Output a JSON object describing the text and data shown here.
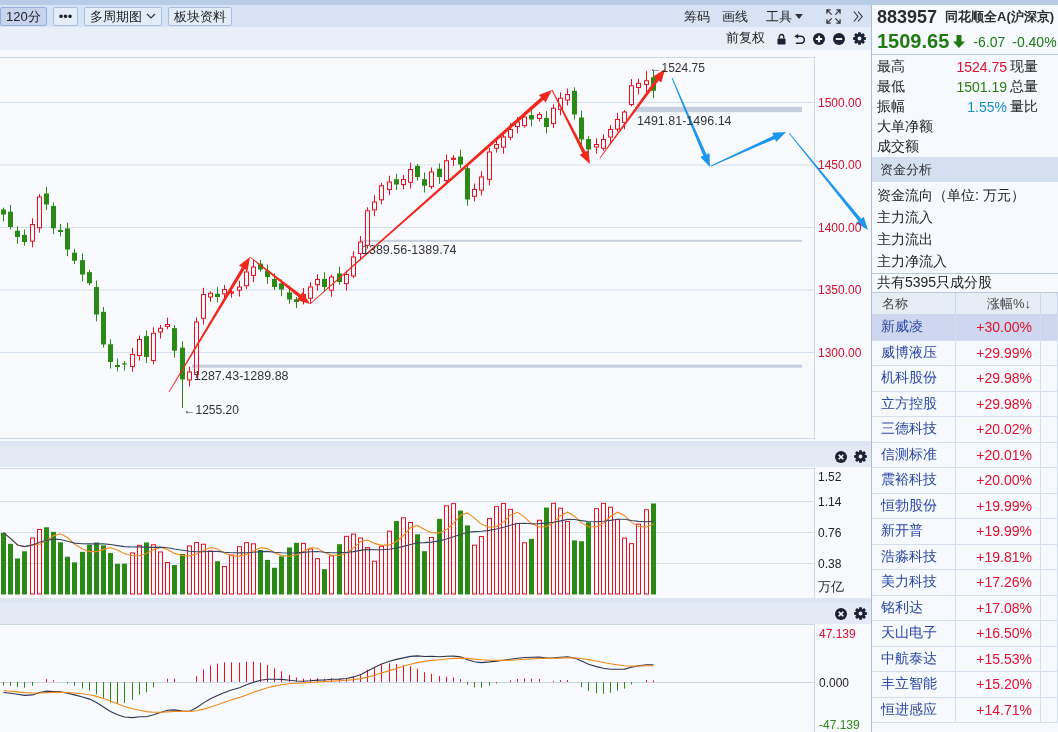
{
  "toolbar": {
    "buttons": [
      {
        "label": "120分",
        "selected": true,
        "kind": "plain"
      },
      {
        "label": "•••",
        "selected": false,
        "kind": "plain"
      },
      {
        "label": "多周期图",
        "selected": false,
        "kind": "dropdown"
      },
      {
        "label": "板块资料",
        "selected": false,
        "kind": "plain"
      }
    ],
    "tools": [
      {
        "label": "筹码",
        "kind": "plain"
      },
      {
        "label": "画线",
        "kind": "plain"
      },
      {
        "label": "工具",
        "kind": "menu"
      }
    ]
  },
  "chart_toolbar": {
    "adjustment": "前复权"
  },
  "price_chart": {
    "axis_labels": [
      "1500.00",
      "1450.00",
      "1400.00",
      "1350.00",
      "1300.00"
    ],
    "high_label": "←1524.75",
    "low_label": "←1255.20",
    "zones": [
      {
        "label": "1491.81-1496.14"
      },
      {
        "label": "1389.56-1389.74"
      },
      {
        "label": "1287.43-1289.88"
      }
    ]
  },
  "volume_panel": {
    "axis_labels": [
      "1.52",
      "1.14",
      "0.76",
      "0.38"
    ],
    "unit": "万亿"
  },
  "macd_panel": {
    "axis_labels": [
      {
        "label": "47.139",
        "color": "#d8102c"
      },
      {
        "label": "0.000",
        "color": "#222222"
      },
      {
        "label": "-47.139",
        "color": "#2b8a16"
      }
    ]
  },
  "quote": {
    "code": "883957",
    "name": "同花顺全A(沪深京)",
    "price": "1509.65",
    "falling": true,
    "change": "-6.07",
    "change_percent": "-0.40%"
  },
  "stats": [
    {
      "label": "最高",
      "value": "1524.75",
      "color": "#e3102a",
      "extra": "现量"
    },
    {
      "label": "最低",
      "value": "1501.19",
      "color": "#2b7d10",
      "extra": "总量"
    },
    {
      "label": "振幅",
      "value": "1.55%",
      "color": "#1a8cc8",
      "extra": "量比"
    },
    {
      "label": "大单净额"
    },
    {
      "label": "成交额"
    }
  ],
  "fund_analysis": {
    "title": "资金分析",
    "rows": [
      "资金流向（单位: 万元）",
      "主力流入",
      "主力流出",
      "主力净流入"
    ]
  },
  "constituents": {
    "summary": "共有5395只成分股",
    "columns": [
      "名称",
      "涨幅%↓"
    ],
    "rows": [
      {
        "name": "新威凌",
        "change": "+30.00%",
        "selected": true
      },
      {
        "name": "威博液压",
        "change": "+29.99%",
        "selected": false
      },
      {
        "name": "机科股份",
        "change": "+29.98%",
        "selected": false
      },
      {
        "name": "立方控股",
        "change": "+29.98%",
        "selected": false
      },
      {
        "name": "三德科技",
        "change": "+20.02%",
        "selected": false
      },
      {
        "name": "信测标准",
        "change": "+20.01%",
        "selected": false
      },
      {
        "name": "震裕科技",
        "change": "+20.00%",
        "selected": false
      },
      {
        "name": "恒勃股份",
        "change": "+19.99%",
        "selected": false
      },
      {
        "name": "新开普",
        "change": "+19.99%",
        "selected": false
      },
      {
        "name": "浩淼科技",
        "change": "+19.81%",
        "selected": false
      },
      {
        "name": "美力科技",
        "change": "+17.26%",
        "selected": false
      },
      {
        "name": "铭利达",
        "change": "+17.08%",
        "selected": false
      },
      {
        "name": "天山电子",
        "change": "+16.50%",
        "selected": false
      },
      {
        "name": "中航泰达",
        "change": "+15.53%",
        "selected": false
      },
      {
        "name": "丰立智能",
        "change": "+15.20%",
        "selected": false
      },
      {
        "name": "恒进感应",
        "change": "+14.71%",
        "selected": false
      }
    ]
  }
}
